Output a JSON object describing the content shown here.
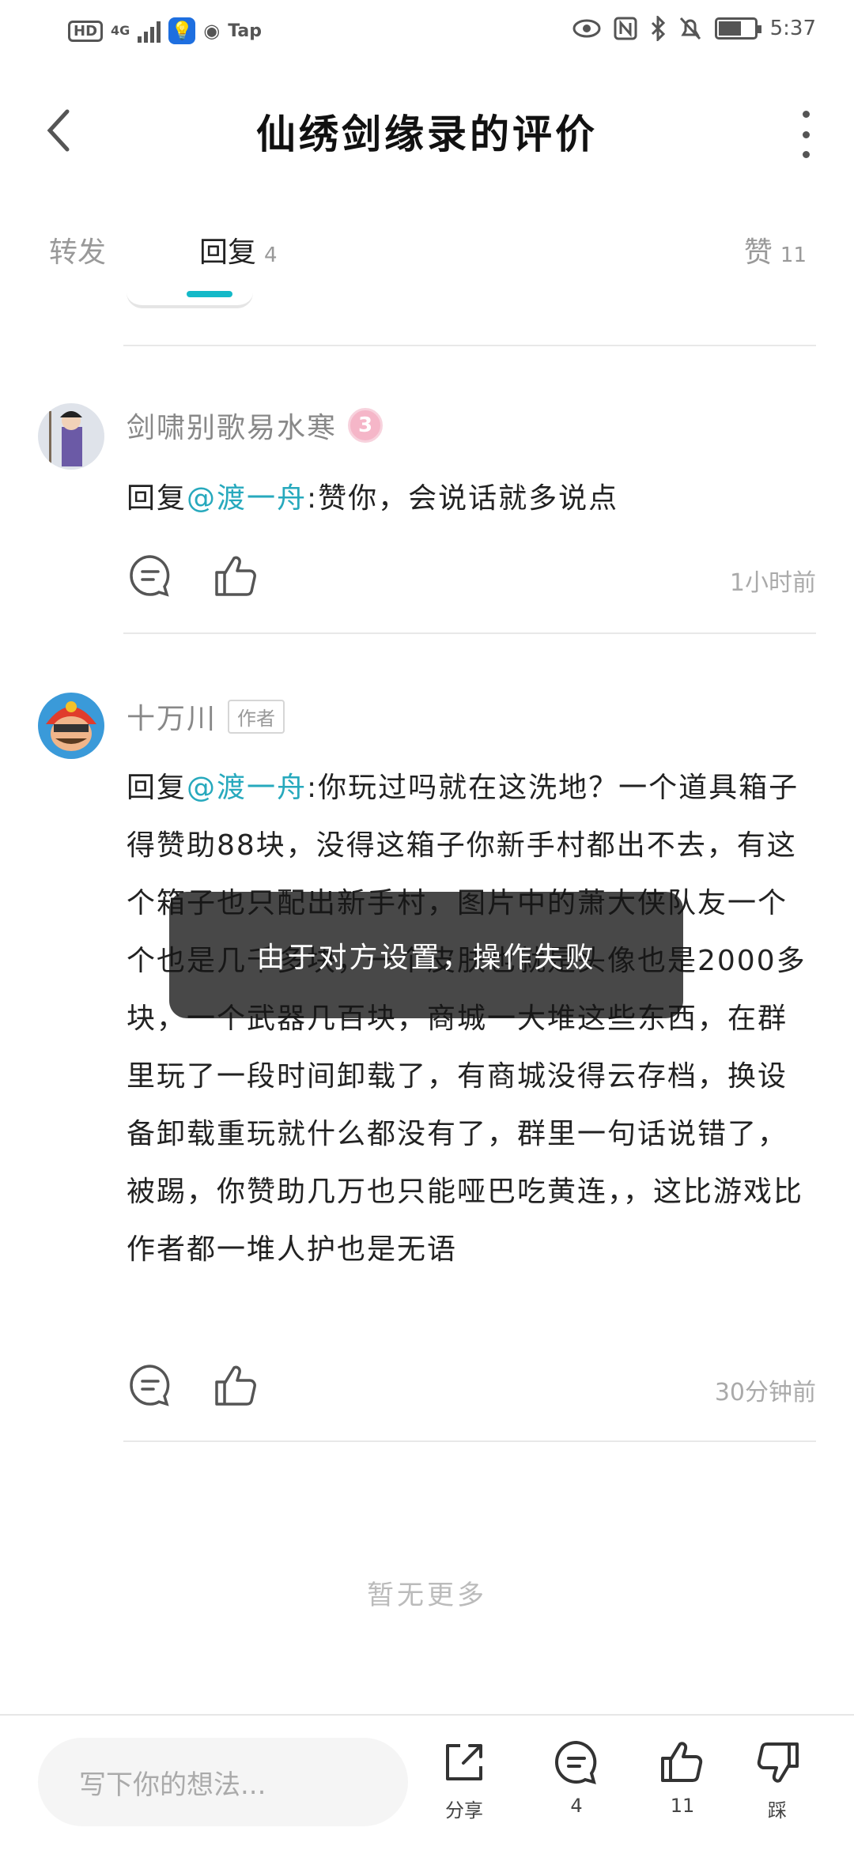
{
  "status_bar": {
    "hd": "HD",
    "network": "4G",
    "app_label": "Tap",
    "time": "5:37"
  },
  "header": {
    "title": "仙绣剑缘录的评价"
  },
  "tabs": {
    "forward": "转发",
    "reply": "回复",
    "reply_count": "4",
    "like": "赞",
    "like_count": "11"
  },
  "comments": [
    {
      "name": "剑啸别歌易水寒",
      "level": "3",
      "reply_prefix": "回复",
      "mention": "@渡一舟",
      "text": ":赞你，会说话就多说点",
      "time": "1小时前"
    },
    {
      "name": "十万川",
      "tag": "作者",
      "reply_prefix": "回复",
      "mention": "@渡一舟",
      "text": ":你玩过吗就在这洗地？一个道具箱子得赞助88块，没得这箱子你新手村都出不去，有这个箱子也只配出新手村，图片中的萧大侠队友一个个也是几千多块，一个皮肤也就是头像也是2000多块，一个武器几百块，商城一大堆这些东西，在群里玩了一段时间卸载了，有商城没得云存档，换设备卸载重玩就什么都没有了，群里一句话说错了，被踢，你赞助几万也只能哑巴吃黄连，，这比游戏比作者都一堆人护也是无语",
      "time": "30分钟前"
    }
  ],
  "no_more": "暂无更多",
  "toast": "由于对方设置，操作失败",
  "bottom_bar": {
    "input_placeholder": "写下你的想法...",
    "share_label": "分享",
    "comment_count": "4",
    "like_count": "11",
    "dislike_label": "踩"
  },
  "colors": {
    "accent": "#14b9c8",
    "mention": "#27a9bd",
    "toast_bg": "#141414"
  }
}
